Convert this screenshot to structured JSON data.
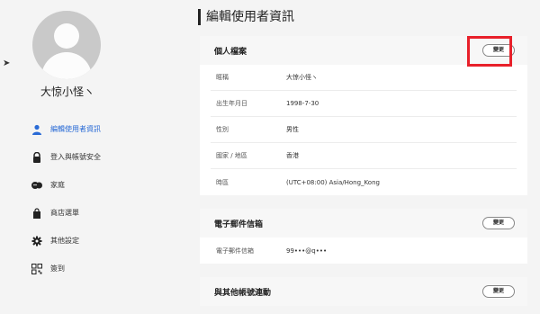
{
  "page_title": "編輯使用者資訊",
  "user": {
    "name": "大惊小怪ヽ"
  },
  "nav": [
    {
      "label": "編輯使用者資訊",
      "icon": "user-icon"
    },
    {
      "label": "登入與帳號安全",
      "icon": "lock-icon"
    },
    {
      "label": "家庭",
      "icon": "family-icon"
    },
    {
      "label": "商店選單",
      "icon": "bag-icon"
    },
    {
      "label": "其他設定",
      "icon": "gear-icon"
    },
    {
      "label": "簽到",
      "icon": "qr-icon"
    }
  ],
  "profile": {
    "title": "個人檔案",
    "edit_label": "變更",
    "fields": [
      {
        "label": "暱稱",
        "value": "大惊小怪ヽ"
      },
      {
        "label": "出生年月日",
        "value": "1998-7-30"
      },
      {
        "label": "性別",
        "value": "男性"
      },
      {
        "label": "國家 / 地區",
        "value": "香港"
      },
      {
        "label": "時區",
        "value": "(UTC+08:00) Asia/Hong_Kong"
      }
    ]
  },
  "email": {
    "title": "電子郵件信箱",
    "edit_label": "變更",
    "fields": [
      {
        "label": "電子郵件信箱",
        "value": "99•••@q•••"
      }
    ]
  },
  "linked": {
    "title": "與其他帳號連動",
    "edit_label": "變更"
  },
  "colors": {
    "active": "#2a6bd6",
    "highlight": "#e8202a"
  }
}
